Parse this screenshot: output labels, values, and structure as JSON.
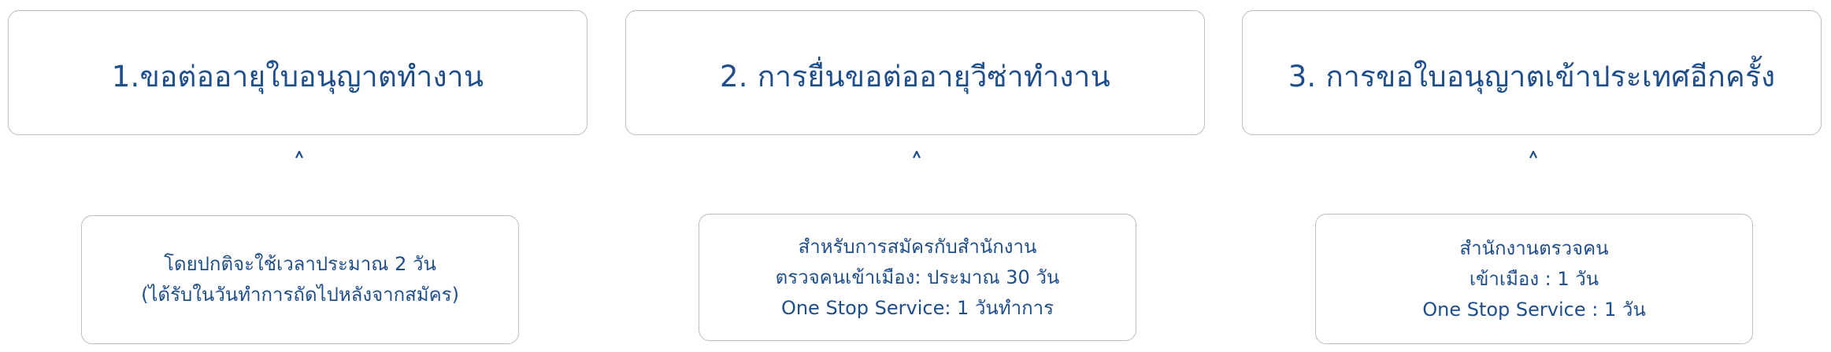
{
  "steps": [
    {
      "title": "1.ขอต่ออายุใบอนุญาตทำงาน",
      "lines": [
        "โดยปกติจะใช้เวลาประมาณ 2 วัน",
        "(ได้รับในวันทำการถัดไปหลังจากสมัคร)"
      ]
    },
    {
      "title": "2. การยื่นขอต่ออายุวีซ่าทำงาน",
      "lines": [
        "สำหรับการสมัครกับสำนักงาน",
        "ตรวจคนเข้าเมือง: ประมาณ 30 วัน",
        "One Stop Service: 1 วันทำการ"
      ]
    },
    {
      "title": "3. การขอใบอนุญาตเข้าประเทศอีกครั้ง",
      "lines": [
        "สำนักงานตรวจคน",
        "เข้าเมือง : 1 วัน",
        "One Stop Service : 1 วัน"
      ]
    }
  ],
  "colors": {
    "text": "#1f4e8c",
    "arrow": "#1f4e8c",
    "border": "#b8bcc4"
  },
  "icons": {
    "connector": "arrow-up-icon"
  }
}
